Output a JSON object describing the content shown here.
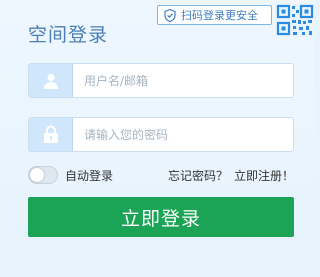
{
  "header": {
    "title": "空间登录",
    "qr_badge_text": "扫码登录更安全",
    "shield_icon": "shield-icon",
    "qr_icon": "qr-code-icon"
  },
  "form": {
    "username": {
      "value": "",
      "placeholder": "用户名/邮箱",
      "icon": "user-icon"
    },
    "password": {
      "value": "",
      "placeholder": "请输入您的密码",
      "icon": "lock-icon"
    }
  },
  "options": {
    "auto_login_label": "自动登录",
    "auto_login_enabled": false,
    "forgot_password": "忘记密码？",
    "register": "立即注册！"
  },
  "submit": {
    "label": "立即登录"
  },
  "colors": {
    "accent_green": "#1ba456",
    "title_blue": "#4a7fb3",
    "badge_blue": "#3f7fc2",
    "icon_bg": "#cfe6fb"
  }
}
